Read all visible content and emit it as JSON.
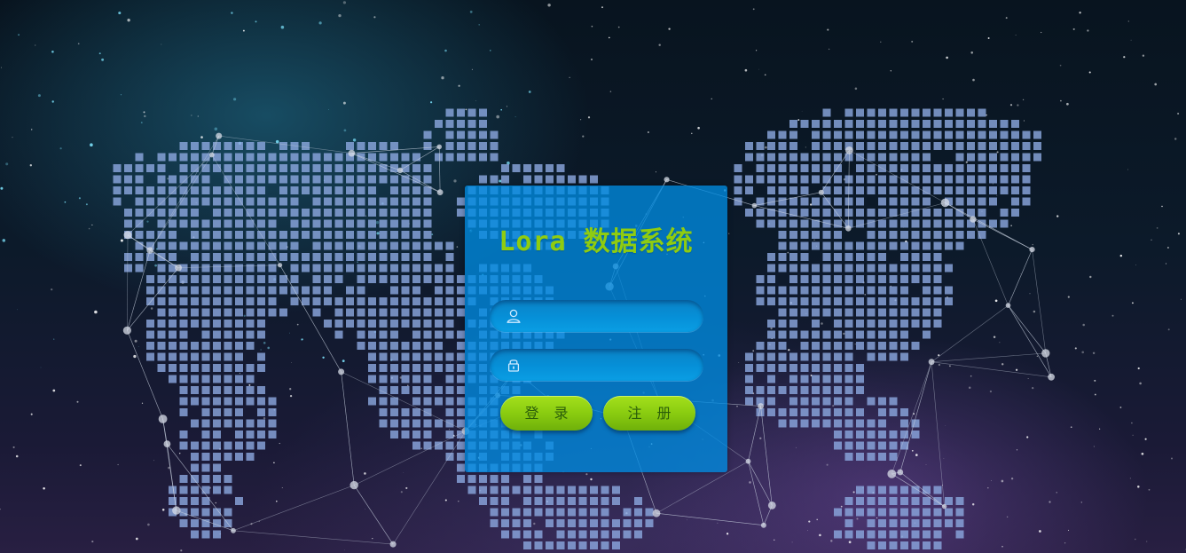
{
  "app": {
    "title": "Lora 数据系统"
  },
  "form": {
    "username": {
      "value": "",
      "placeholder": "",
      "icon": "user-icon"
    },
    "password": {
      "value": "",
      "placeholder": "",
      "icon": "lock-icon"
    }
  },
  "buttons": {
    "login_label": "登 录",
    "register_label": "注 册"
  },
  "colors": {
    "card": "#008ce1",
    "title": "#8fcc10",
    "button": "#8acc10",
    "button_text": "#2b5e0a"
  }
}
